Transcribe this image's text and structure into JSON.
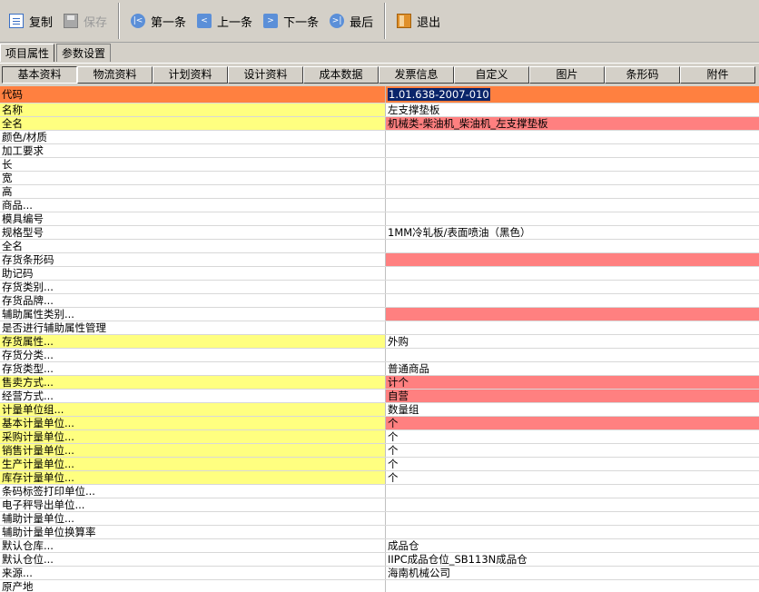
{
  "toolbar": {
    "copy": "复制",
    "save": "保存",
    "first": "第一条",
    "prev": "上一条",
    "next": "下一条",
    "last": "最后",
    "exit": "退出"
  },
  "outer_tabs": [
    "项目属性",
    "参数设置"
  ],
  "inner_tabs": [
    "基本资料",
    "物流资料",
    "计划资料",
    "设计资料",
    "成本数据",
    "发票信息",
    "自定义",
    "图片",
    "条形码",
    "附件"
  ],
  "header": {
    "label": "代码",
    "value": "1.01.638-2007-010"
  },
  "rows": [
    {
      "label": "名称",
      "value": "左支撑垫板",
      "req": true,
      "warn": false
    },
    {
      "label": "全名",
      "value": "机械类-柴油机_柴油机_左支撑垫板",
      "req": true,
      "warn": true
    },
    {
      "label": "颜色/材质",
      "value": "",
      "req": false,
      "warn": false
    },
    {
      "label": "加工要求",
      "value": "",
      "req": false,
      "warn": false
    },
    {
      "label": "长",
      "value": "",
      "req": false,
      "warn": false
    },
    {
      "label": "宽",
      "value": "",
      "req": false,
      "warn": false
    },
    {
      "label": "高",
      "value": "",
      "req": false,
      "warn": false
    },
    {
      "label": "商品...",
      "value": "",
      "req": false,
      "warn": false
    },
    {
      "label": "模具编号",
      "value": "",
      "req": false,
      "warn": false
    },
    {
      "label": "规格型号",
      "value": "1MM冷轧板/表面喷油（黑色）",
      "req": false,
      "warn": false
    },
    {
      "label": "全名",
      "value": "",
      "req": false,
      "warn": false
    },
    {
      "label": "存货条形码",
      "value": "",
      "req": false,
      "warn": true
    },
    {
      "label": "助记码",
      "value": "",
      "req": false,
      "warn": false
    },
    {
      "label": "存货类别...",
      "value": "",
      "req": false,
      "warn": false
    },
    {
      "label": "存货品牌...",
      "value": "",
      "req": false,
      "warn": false
    },
    {
      "label": "辅助属性类别...",
      "value": "",
      "req": false,
      "warn": true
    },
    {
      "label": "是否进行辅助属性管理",
      "value": "",
      "req": false,
      "warn": false
    },
    {
      "label": "存货属性...",
      "value": "外购",
      "req": true,
      "warn": false
    },
    {
      "label": "存货分类...",
      "value": "",
      "req": false,
      "warn": false
    },
    {
      "label": "存货类型...",
      "value": "普通商品",
      "req": false,
      "warn": false
    },
    {
      "label": "售卖方式...",
      "value": "计个",
      "req": true,
      "warn": true
    },
    {
      "label": "经营方式...",
      "value": "自营",
      "req": false,
      "warn": true
    },
    {
      "label": "计量单位组...",
      "value": "数量组",
      "req": true,
      "warn": false
    },
    {
      "label": "基本计量单位...",
      "value": "个",
      "req": true,
      "warn": true
    },
    {
      "label": "采购计量单位...",
      "value": "个",
      "req": true,
      "warn": false
    },
    {
      "label": "销售计量单位...",
      "value": "个",
      "req": true,
      "warn": false
    },
    {
      "label": "生产计量单位...",
      "value": "个",
      "req": true,
      "warn": false
    },
    {
      "label": "库存计量单位...",
      "value": "个",
      "req": true,
      "warn": false
    },
    {
      "label": "条码标签打印单位...",
      "value": "",
      "req": false,
      "warn": false
    },
    {
      "label": "电子秤导出单位...",
      "value": "",
      "req": false,
      "warn": false
    },
    {
      "label": "辅助计量单位...",
      "value": "",
      "req": false,
      "warn": false
    },
    {
      "label": "辅助计量单位换算率",
      "value": "",
      "req": false,
      "warn": false
    },
    {
      "label": "默认仓库...",
      "value": "成品仓",
      "req": false,
      "warn": false
    },
    {
      "label": "默认仓位...",
      "value": "IIPC成品仓位_SB113N成品仓",
      "req": false,
      "warn": false
    },
    {
      "label": "来源...",
      "value": "海南机械公司",
      "req": false,
      "warn": false
    },
    {
      "label": "原产地",
      "value": "",
      "req": false,
      "warn": false
    }
  ]
}
